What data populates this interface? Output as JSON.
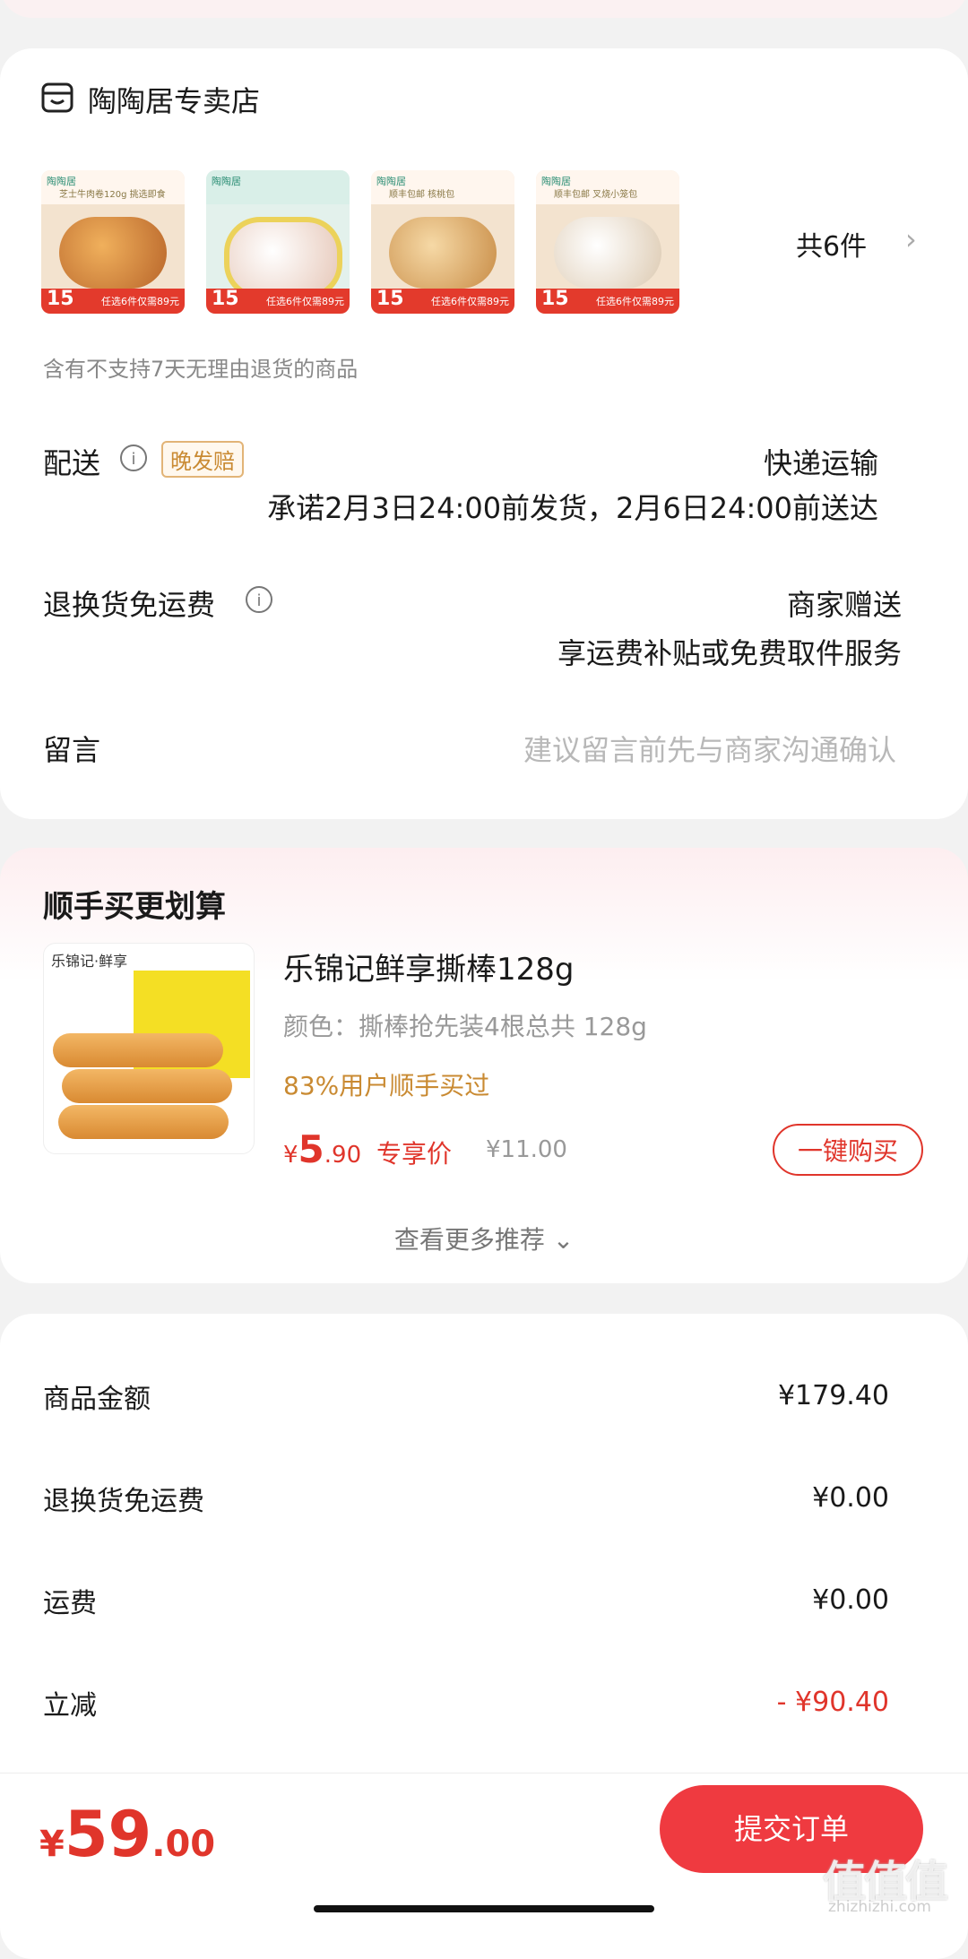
{
  "shop": {
    "name": "陶陶居专卖店",
    "products": [
      {
        "logo": "陶陶居",
        "blurb": "芝士牛肉卷120g 挑选即食",
        "badge": "15",
        "promo": "任选6件仅需89元"
      },
      {
        "logo": "陶陶居",
        "blurb": "",
        "badge": "15",
        "promo": "任选6件仅需89元"
      },
      {
        "logo": "陶陶居",
        "blurb": "顺丰包邮 核桃包",
        "badge": "15",
        "promo": "任选6件仅需89元"
      },
      {
        "logo": "陶陶居",
        "blurb": "顺丰包邮 叉烧小笼包",
        "badge": "15",
        "promo": "任选6件仅需89元"
      }
    ],
    "count_label": "共6件",
    "return_note": "含有不支持7天无理由退货的商品"
  },
  "delivery": {
    "label": "配送",
    "badge": "晚发赔",
    "method": "快递运输",
    "promise": "承诺2月3日24:00前发货，2月6日24:00前送达"
  },
  "return_shipping": {
    "label": "退换货免运费",
    "value": "商家赠送",
    "desc": "享运费补贴或免费取件服务"
  },
  "message": {
    "label": "留言",
    "placeholder": "建议留言前先与商家沟通确认"
  },
  "recommend": {
    "title": "顺手买更划算",
    "item": {
      "brand": "乐锦记·鲜享",
      "name": "乐锦记鲜享撕棒128g",
      "spec": "颜色：撕棒抢先装4根总共 128g",
      "pct": "83%用户顺手买过",
      "price_symbol": "¥",
      "price_int": "5",
      "price_dec": ".90",
      "price_tag": "专享价",
      "orig_price": "¥11.00",
      "buy_label": "一键购买"
    },
    "more_label": "查看更多推荐 ⌄"
  },
  "summary": {
    "rows": [
      {
        "label": "商品金额",
        "value": "¥179.40"
      },
      {
        "label": "退换货免运费",
        "value": "¥0.00"
      },
      {
        "label": "运费",
        "value": "¥0.00"
      },
      {
        "label": "立减",
        "value": "- ¥90.40"
      }
    ]
  },
  "bottom": {
    "currency": "¥",
    "total_int": "59",
    "total_dec": ".00",
    "submit_label": "提交订单"
  },
  "watermark": {
    "main": "值值值",
    "sub": "zhizhizhi.com"
  }
}
